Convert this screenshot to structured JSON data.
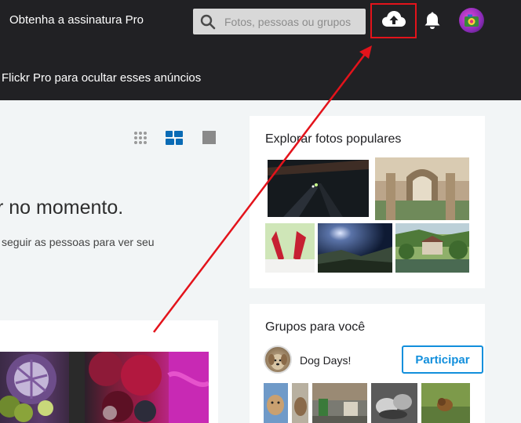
{
  "topbar": {
    "pro_link": "Obtenha a assinatura Pro",
    "search_placeholder": "Fotos, pessoas ou grupos"
  },
  "adbar": {
    "text": "Flickr Pro para ocultar esses anúncios"
  },
  "feed": {
    "empty_title": "r no momento.",
    "empty_subtitle": "seguir as pessoas para ver seu"
  },
  "explore": {
    "title": "Explorar fotos populares"
  },
  "groups": {
    "title": "Grupos para você",
    "group_name": "Dog Days!",
    "join_label": "Participar"
  },
  "colors": {
    "nav_bg": "#212124",
    "accent_blue": "#128fdc",
    "annotation_red": "#e3131b"
  }
}
